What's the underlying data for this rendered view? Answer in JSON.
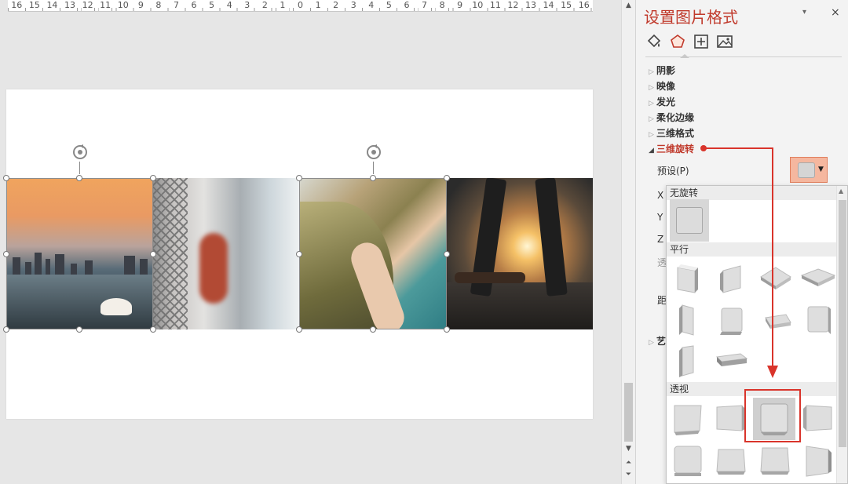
{
  "ruler": {
    "labels": [
      "16",
      "15",
      "14",
      "13",
      "12",
      "11",
      "10",
      "9",
      "8",
      "7",
      "6",
      "5",
      "4",
      "3",
      "2",
      "1",
      "0",
      "1",
      "2",
      "3",
      "4",
      "5",
      "6",
      "7",
      "8",
      "9",
      "10",
      "11",
      "12",
      "13",
      "14",
      "15",
      "16"
    ]
  },
  "pane": {
    "title": "设置图片格式",
    "menu_icon": "▾",
    "close_icon": "×",
    "tabs": [
      "fill-line-icon",
      "effects-icon",
      "size-properties-icon",
      "picture-icon"
    ],
    "sections": [
      {
        "label": "阴影",
        "state": "collapsed"
      },
      {
        "label": "映像",
        "state": "collapsed"
      },
      {
        "label": "发光",
        "state": "collapsed"
      },
      {
        "label": "柔化边缘",
        "state": "collapsed"
      },
      {
        "label": "三维格式",
        "state": "collapsed"
      },
      {
        "label": "三维旋转",
        "state": "expanded"
      }
    ],
    "preset_label": "预设(P)",
    "partial_labels": [
      "X",
      "Y",
      "Z",
      "透",
      "距",
      "艺"
    ]
  },
  "gallery": {
    "groups": [
      {
        "label": "无旋转",
        "count": 1
      },
      {
        "label": "平行",
        "count": 10
      },
      {
        "label": "透视",
        "count": 8
      }
    ]
  },
  "colors": {
    "accent": "#c0392b",
    "annotation": "#d9342b",
    "preset_bg": "#f5b79f"
  }
}
